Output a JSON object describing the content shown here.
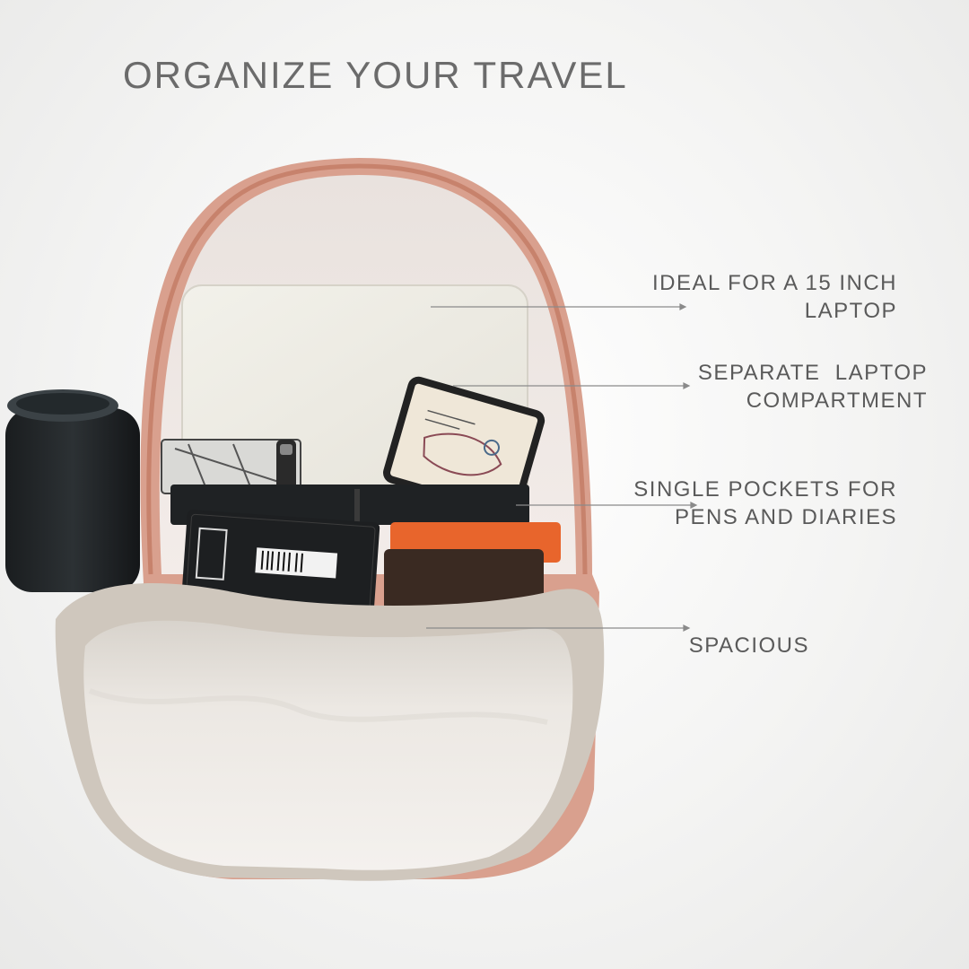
{
  "headline": "ORGANIZE YOUR TRAVEL",
  "callouts": [
    {
      "line1": "IDEAL FOR A 15 INCH",
      "line2": "LAPTOP"
    },
    {
      "line1": "SEPARATE  LAPTOP",
      "line2": "COMPARTMENT"
    },
    {
      "line1": "SINGLE POCKETS FOR",
      "line2": "PENS AND DIARIES"
    },
    {
      "line1": "SPACIOUS",
      "line2": ""
    }
  ],
  "colors": {
    "text": "#5a5a5a",
    "bag_shell": "#d9a08e",
    "bag_lining": "#ece6e2",
    "pouch": "#e7e2dc",
    "leader": "#8a8a8a"
  }
}
